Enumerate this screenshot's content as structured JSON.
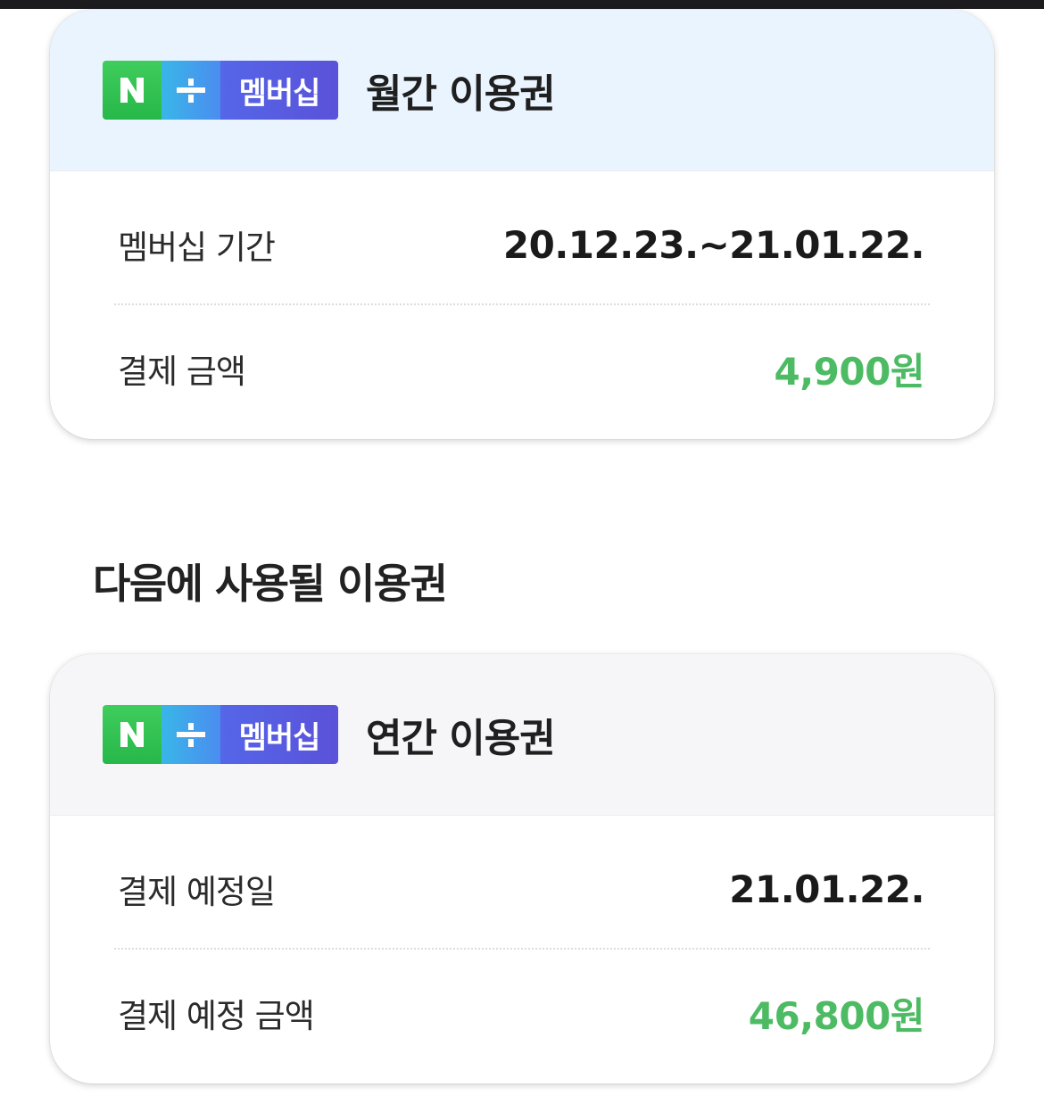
{
  "current_plan": {
    "badge": {
      "n": "N",
      "plus": "+",
      "text": "멤버십"
    },
    "title": "월간 이용권",
    "rows": [
      {
        "label": "멤버십 기간",
        "value": "20.12.23.~21.01.22."
      },
      {
        "label": "결제 금액",
        "value": "4,900원"
      }
    ]
  },
  "next_section_title": "다음에 사용될 이용권",
  "next_plan": {
    "badge": {
      "n": "N",
      "plus": "+",
      "text": "멤버십"
    },
    "title": "연간 이용권",
    "rows": [
      {
        "label": "결제 예정일",
        "value": "21.01.22."
      },
      {
        "label": "결제 예정 금액",
        "value": "46,800원"
      }
    ]
  },
  "colors": {
    "accent_green": "#4dbb63",
    "current_header_bg": "#e9f4fe",
    "next_header_bg": "#f6f6f9"
  }
}
